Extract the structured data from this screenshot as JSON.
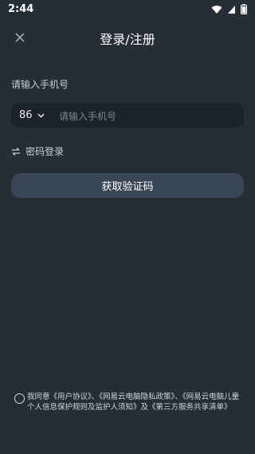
{
  "status": {
    "time": "2:44",
    "icons": [
      "wifi-icon",
      "signal-icon",
      "battery-icon"
    ]
  },
  "header": {
    "title": "登录/注册",
    "close_icon": "close-icon"
  },
  "form": {
    "phone_label": "请输入手机号",
    "country_code": "86",
    "phone_placeholder": "请输入手机号",
    "password_login": "密码登录",
    "get_code_button": "获取验证码"
  },
  "agreement": {
    "prefix": "我同意",
    "user_agreement": "《用户协议》",
    "sep1": "、",
    "privacy_policy": "《网易云电脑隐私政策》",
    "sep2": "、",
    "child_privacy": "《网易云电脑儿童个人信息保护规则及监护人须知》",
    "and": "及",
    "third_party": "《第三方服务共享清单》"
  },
  "colors": {
    "background": "#252d37",
    "input_bg": "#1b222b",
    "button_bg": "#3a4656"
  }
}
